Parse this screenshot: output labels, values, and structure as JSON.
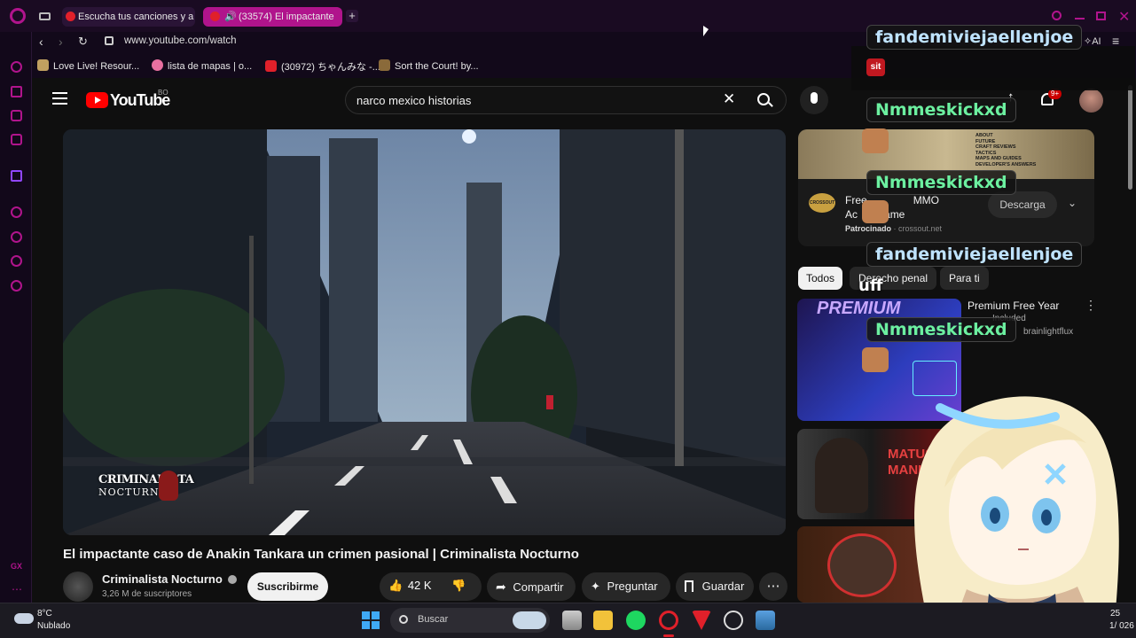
{
  "browser": {
    "tabs": [
      {
        "title": "Escucha tus canciones y a"
      },
      {
        "title": "(33574) El impactante"
      }
    ],
    "new_tab_label": "+",
    "url": "www.youtube.com/watch",
    "ai_label": "AI",
    "bookmarks": [
      {
        "label": "Love Live! Resour..."
      },
      {
        "label": "lista de mapas | o..."
      },
      {
        "label": "(30972) ちゃんみな -..."
      },
      {
        "label": "Sort the Court! by..."
      }
    ],
    "sidebar_bottom_label": "GX"
  },
  "youtube": {
    "logo_text": "YouTube",
    "region": "BO",
    "search_value": "narco mexico historias",
    "notifications_count": "9+",
    "video": {
      "title": "El impactante caso de Anakin Tankara un crimen pasional | Criminalista Nocturno",
      "watermark_line1": "CRIMINALISTA",
      "watermark_line2": "NOCTURNO"
    },
    "channel": {
      "name": "Criminalista Nocturno",
      "subscribers": "3,26 M de suscriptores",
      "subscribe_label": "Suscribirme"
    },
    "actions": {
      "likes": "42 K",
      "share": "Compartir",
      "ask": "Preguntar",
      "save": "Guardar"
    },
    "ad": {
      "banner_text": [
        "ABOUT",
        "FUTURE",
        "CRAFT REVIEWS",
        "TACTICS",
        "MAPS AND GUIDES",
        "DEVELOPER'S ANSWERS"
      ],
      "title_fragment_1": "Free",
      "title_fragment_2": "MMO",
      "title_fragment_3": "Ac",
      "title_fragment_4": "ame",
      "sponsored": "Patrocinado",
      "domain": "crossout.net",
      "download": "Descarga",
      "brand": "CROSSOUT"
    },
    "chips": [
      "Todos",
      "Derecho penal",
      "Para ti"
    ],
    "recommendations": [
      {
        "title": "Premium Free Year",
        "meta": "Included",
        "channel": "brainlightflux",
        "thumb_text": "PREMIUM"
      },
      {
        "thumb_text_1": "MATUS",
        "thumb_text_2": "MANI"
      }
    ]
  },
  "stream_overlay": {
    "chat": [
      {
        "user": "fandemiviejaellenjoe"
      },
      {
        "user": "Nmmeskickxd"
      },
      {
        "user": "Nmmeskickxd"
      },
      {
        "user": "fandemiviejaellenjoe"
      },
      {
        "message": "uff"
      },
      {
        "user": "Nmmeskickxd"
      }
    ],
    "emote_text": "sit"
  },
  "taskbar": {
    "weather_temp": "8°C",
    "weather_desc": "Nublado",
    "search_label": "Buscar",
    "time_partial": "25",
    "date_partial": "1/ 026"
  },
  "colors": {
    "accent": "#e0202a",
    "opera_accent": "#b0148c",
    "chat_green": "#6cf0a0"
  }
}
